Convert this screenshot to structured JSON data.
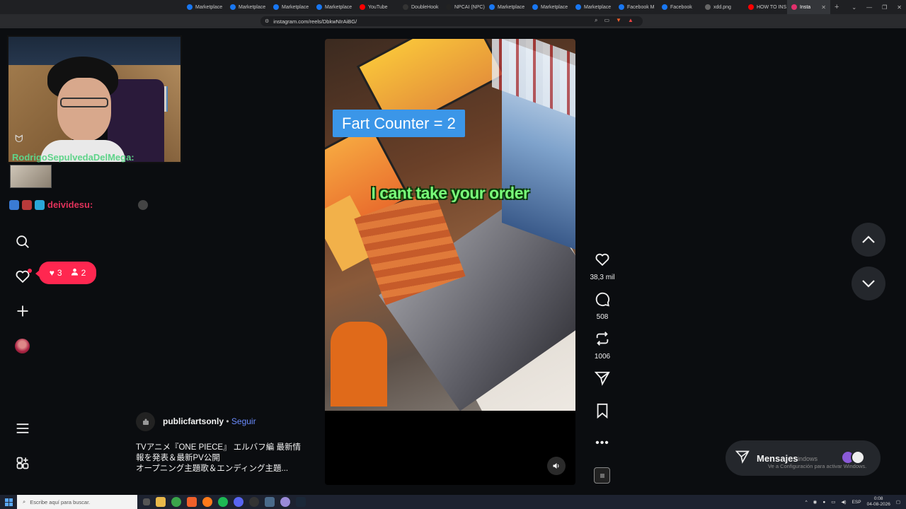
{
  "browser": {
    "tabs": [
      {
        "label": "Marketplace",
        "color": "#1877f2"
      },
      {
        "label": "Marketplace",
        "color": "#1877f2"
      },
      {
        "label": "Marketplace",
        "color": "#1877f2"
      },
      {
        "label": "Marketplace",
        "color": "#1877f2"
      },
      {
        "label": "YouTube",
        "color": "#ff0000"
      },
      {
        "label": "DoubleHook",
        "color": "#333333"
      },
      {
        "label": "NPCAI (NPC)",
        "color": "#222222"
      },
      {
        "label": "Marketplace",
        "color": "#1877f2"
      },
      {
        "label": "Marketplace",
        "color": "#1877f2"
      },
      {
        "label": "Marketplace",
        "color": "#1877f2"
      },
      {
        "label": "Facebook M",
        "color": "#1877f2"
      },
      {
        "label": "Facebook",
        "color": "#1877f2"
      },
      {
        "label": "xdd.png",
        "color": "#666666"
      },
      {
        "label": "HOW TO INS",
        "color": "#ff0000"
      },
      {
        "label": "Insta",
        "color": "#e1306c"
      }
    ],
    "url": "instagram.com/reels/DbkwNIrAiBG/"
  },
  "chat": {
    "user1": "RodrigoSepulvedaDelMega:",
    "user2": "deividesu:"
  },
  "notifications": {
    "likes": "3",
    "follows": "2"
  },
  "reel": {
    "overlay_counter": "Fart Counter =  2",
    "caption_text": "I cant take your order",
    "likes": "38,3 mil",
    "comments": "508",
    "reposts": "1006",
    "author": "publicfartsonly",
    "separator": "•",
    "follow": "Seguir",
    "description_line1": "TVアニメ『ONE PIECE』 エルバフ編 最新情",
    "description_line2": "報を発表＆最新PV公開",
    "description_line3": "オープニング主題歌＆エンディング主題..."
  },
  "messages": {
    "label": "Mensajes",
    "watermark_title": "indows",
    "watermark": "Ve a Configuración para activar Windows."
  },
  "taskbar": {
    "search_placeholder": "Escribe aquí para buscar.",
    "lang": "ESP",
    "time": "0:08",
    "date": "04-08-2026"
  }
}
